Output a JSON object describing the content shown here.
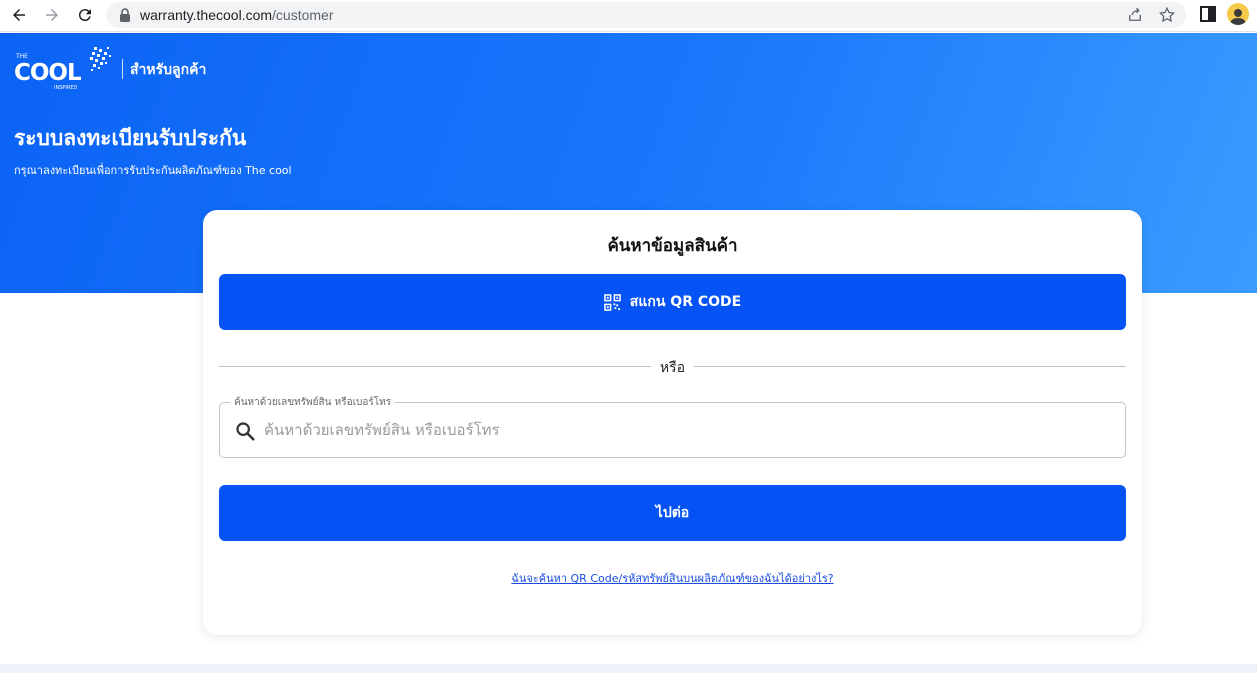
{
  "browser": {
    "url_host": "warranty.thecool.com",
    "url_path": "/customer"
  },
  "header": {
    "logo_small_top": "THE",
    "logo_main": "COOL",
    "logo_small_bottom": "INSPIRED",
    "subtitle": "สำหรับลูกค้า",
    "title": "ระบบลงทะเบียนรับประกัน",
    "description": "กรุณาลงทะเบียนเพื่อการรับประกันผลิตภัณฑ์ของ The cool"
  },
  "card": {
    "title": "ค้นหาข้อมูลสินค้า",
    "scan_button_label": "สแกน QR CODE",
    "divider_text": "หรือ",
    "search_legend": "ค้นหาด้วยเลขทรัพย์สิน หรือเบอร์โทร",
    "search_placeholder": "ค้นหาด้วยเลขทรัพย์สิน หรือเบอร์โทร",
    "search_value": "",
    "next_button_label": "ไปต่อ",
    "help_link": "ฉันจะค้นหา QR Code/รหัสทรัพย์สินบนผลิตภัณฑ์ของฉันได้อย่างไร?"
  },
  "icons": {
    "back": "arrow-left-icon",
    "forward": "arrow-right-icon",
    "reload": "reload-icon",
    "lock": "lock-icon",
    "share": "share-icon",
    "bookmark": "star-icon",
    "sidepanel": "side-panel-icon",
    "profile": "profile-avatar-icon",
    "qr": "qr-code-icon",
    "search": "search-icon"
  },
  "colors": {
    "brand_blue": "#0553f5",
    "hero_start": "#0b63f5",
    "hero_end": "#3a9cff",
    "link": "#1a4ee0"
  }
}
